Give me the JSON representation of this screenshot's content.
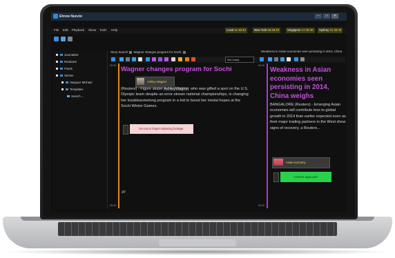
{
  "app": {
    "title": "Ehrew Nunzio",
    "window_buttons": [
      "–",
      "□",
      "×"
    ]
  },
  "menu": [
    "File",
    "Edit",
    "Playback",
    "Show",
    "Tools",
    "Help"
  ],
  "clocks": [
    {
      "city": "Local",
      "time": "11:48:40"
    },
    {
      "city": "New York",
      "time": "05:48:40"
    },
    {
      "city": "Singapore",
      "time": "17:48:40"
    },
    {
      "city": "Sydney",
      "time": "21:48:40"
    }
  ],
  "tree": [
    {
      "label": "Journalists",
      "level": 0
    },
    {
      "label": "Rundown",
      "level": 0
    },
    {
      "label": "Feeds",
      "level": 0
    },
    {
      "label": "Stories",
      "level": 0
    },
    {
      "label": "Vasquez Michael",
      "level": 1
    },
    {
      "label": "Templates",
      "level": 1
    },
    {
      "label": "Search ...",
      "level": 2
    }
  ],
  "story": {
    "tab_label": "Story Search",
    "tab_title": "Wagner changes program for Sochi",
    "status": "Not ready",
    "time_start": "00:00",
    "time_end": "00:00",
    "title": "Wagner changes program for Sochi",
    "clip_label": "Ashley Wagner",
    "body_lead": "(Reuters) - Figure skater ",
    "body_highlight": "AshleyWagner",
    "body_rest": ", who was gifted a spot on the U.S. Olympic team despite an error-strewn national championships, is changing her troublesomelong program in a bid to boost her medal hopes at the Sochi Winter Games.",
    "note": "Do not to forget replacing footage.",
    "signature": "////"
  },
  "right": {
    "tab_title": "Weakness in Asian economies seen persisting in 2014, China",
    "time_start": "00:00",
    "time_end": "00:00",
    "title": "Weakness in Asian economies seen persisting in 2014, China weighs",
    "body": "BANGALORE (Reuters) - Emerging Asian economies will contribute less to global growth in 2014 than earlier expected even as their major trading partners in the West show signs of recovery, a Reuters...",
    "clip_label": "Asian economy",
    "note": "Content approval?"
  },
  "colors": {
    "accent_purple": "#c64fdc",
    "accent_orange": "#e38a1b",
    "note_pink": "#f7d4d7",
    "note_green": "#28d24b",
    "clock_yellow": "#f3d64b"
  }
}
